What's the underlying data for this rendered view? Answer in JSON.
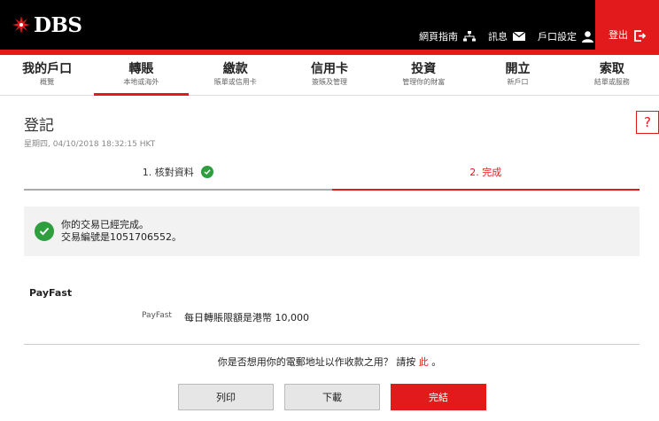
{
  "header": {
    "brand": "DBS",
    "links": [
      {
        "label": "網頁指南",
        "icon": "sitemap-icon"
      },
      {
        "label": "訊息",
        "icon": "envelope-icon"
      },
      {
        "label": "戶口設定",
        "icon": "user-icon"
      }
    ],
    "logout": {
      "label": "登出",
      "icon": "logout-icon"
    },
    "brand_color": "#e31a1c"
  },
  "nav": [
    {
      "label": "我的戶口",
      "sub": "概覽"
    },
    {
      "label": "轉賬",
      "sub": "本地或海外",
      "active": true
    },
    {
      "label": "繳款",
      "sub": "賬單或信用卡"
    },
    {
      "label": "信用卡",
      "sub": "簽賬及管理"
    },
    {
      "label": "投資",
      "sub": "管理你的財富"
    },
    {
      "label": "開立",
      "sub": "新戶口"
    },
    {
      "label": "索取",
      "sub": "結單或服務"
    }
  ],
  "page": {
    "title": "登記",
    "timestamp": "星期四, 04/10/2018 18:32:15 HKT",
    "help": "?"
  },
  "steps": [
    {
      "label": "1. 核對資料",
      "state": "done"
    },
    {
      "label": "2. 完成",
      "state": "current"
    }
  ],
  "success": {
    "line1": "你的交易已經完成。",
    "line2": "交易編號是1051706552。"
  },
  "payfast": {
    "title": "PayFast",
    "label": "PayFast",
    "value": "每日轉賬限額是港幣 10,000"
  },
  "email_prompt": {
    "text": "你是否想用你的電郵地址以作收款之用？ 請按",
    "link": "此",
    "suffix": "。"
  },
  "buttons": {
    "print": "列印",
    "download": "下載",
    "finish": "完結"
  }
}
